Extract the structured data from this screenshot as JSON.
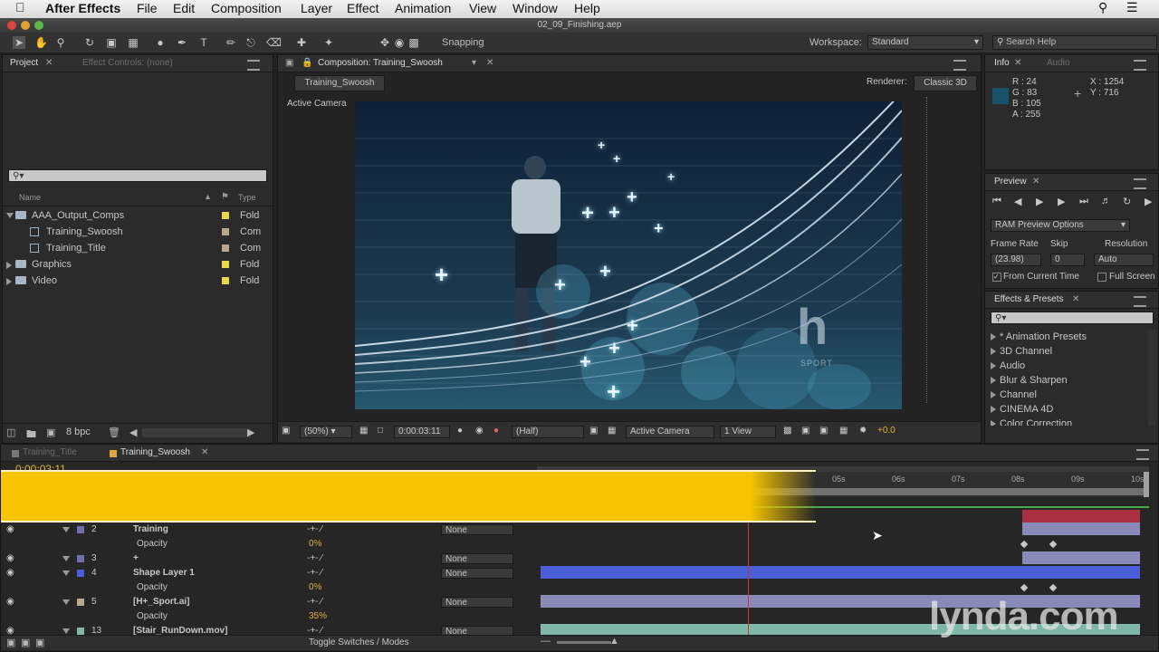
{
  "menubar": {
    "app": "After Effects",
    "items": [
      "File",
      "Edit",
      "Composition",
      "Layer",
      "Effect",
      "Animation",
      "View",
      "Window",
      "Help"
    ]
  },
  "window": {
    "title": "02_09_Finishing.aep"
  },
  "toolbar": {
    "snapping_label": "Snapping",
    "workspace_label": "Workspace:",
    "workspace_value": "Standard",
    "search_placeholder": "Search Help"
  },
  "project_panel": {
    "tab_project": "Project",
    "tab_effect_controls": "Effect Controls: (none)",
    "col_name": "Name",
    "col_type": "Type",
    "items": [
      {
        "name": "AAA_Output_Comps",
        "type": "Fold",
        "kind": "folder",
        "color": "#e8d84a"
      },
      {
        "name": "Training_Swoosh",
        "type": "Com",
        "kind": "comp",
        "color": "#b8a98a"
      },
      {
        "name": "Training_Title",
        "type": "Com",
        "kind": "comp",
        "color": "#b8a98a"
      },
      {
        "name": "Graphics",
        "type": "Fold",
        "kind": "folder",
        "color": "#e8d84a"
      },
      {
        "name": "Video",
        "type": "Fold",
        "kind": "folder",
        "color": "#e8d84a"
      }
    ],
    "bpc": "8 bpc"
  },
  "composition_panel": {
    "tab": "Composition: Training_Swoosh",
    "comp_button": "Training_Swoosh",
    "renderer_label": "Renderer:",
    "renderer_value": "Classic 3D",
    "camera_label": "Active Camera",
    "zoom": "(50%)",
    "timecode": "0:00:03:11",
    "resolution": "(Half)",
    "view_camera": "Active Camera",
    "view_count": "1 View",
    "exposure": "+0.0",
    "logo_letter": "h",
    "logo_text": "SPORT"
  },
  "info_panel": {
    "tab_info": "Info",
    "tab_audio": "Audio",
    "r": "R : 24",
    "g": "G : 83",
    "b": "B : 105",
    "a": "A : 255",
    "x": "X : 1254",
    "y": "Y : 716",
    "swatch": "#185369"
  },
  "preview_panel": {
    "tab": "Preview",
    "ram_options": "RAM Preview Options",
    "frame_rate_label": "Frame Rate",
    "skip_label": "Skip",
    "resolution_label": "Resolution",
    "frame_rate_value": "(23.98)",
    "skip_value": "0",
    "resolution_value": "Auto",
    "from_current": "From Current Time",
    "full_screen": "Full Screen"
  },
  "effects_panel": {
    "tab": "Effects & Presets",
    "items": [
      "* Animation Presets",
      "3D Channel",
      "Audio",
      "Blur & Sharpen",
      "Channel",
      "CINEMA 4D",
      "Color Correction"
    ]
  },
  "timeline": {
    "tabs": [
      "Training_Title",
      "Training_Swoosh"
    ],
    "timecode": "0:00:03:11",
    "ruler": [
      "05s",
      "06s",
      "07s",
      "08s",
      "09s",
      "10s"
    ],
    "toggle_label": "Toggle Switches / Modes",
    "layers": [
      {
        "num": "2",
        "name": "Training",
        "parent": "None",
        "label": "#6f6fb0"
      },
      {
        "prop": "Opacity",
        "value": "0%"
      },
      {
        "num": "3",
        "name": "+",
        "parent": "None",
        "label": "#6f6fb0"
      },
      {
        "num": "4",
        "name": "Shape Layer 1",
        "parent": "None",
        "label": "#4a5ed8"
      },
      {
        "prop": "Opacity",
        "value": "0%"
      },
      {
        "num": "5",
        "name": "[H+_Sport.ai]",
        "parent": "None",
        "label": "#b8a98a"
      },
      {
        "prop": "Opacity",
        "value": "35%"
      },
      {
        "num": "13",
        "name": "[Stair_RunDown.mov]",
        "parent": "None",
        "label": "#7fb8a8"
      }
    ]
  },
  "watermark": "lynda.com"
}
